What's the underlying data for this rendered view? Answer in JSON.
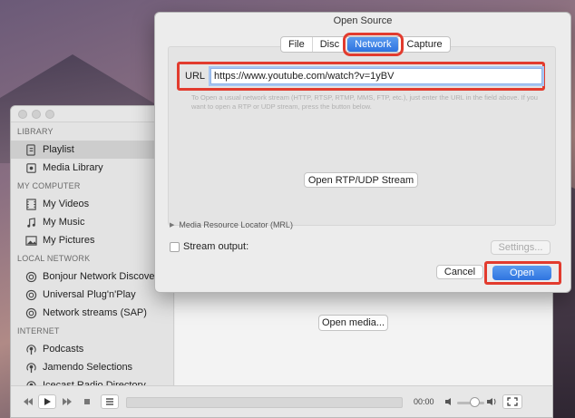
{
  "dialog": {
    "title": "Open Source",
    "tabs": [
      "File",
      "Disc",
      "Network",
      "Capture"
    ],
    "active_tab": "Network",
    "url_label": "URL",
    "url_value": "https://www.youtube.com/watch?v=1yBV",
    "help_text": "To Open a usual network stream (HTTP, RTSP, RTMP, MMS, FTP, etc.), just enter the URL in the field above. If you want to open a RTP or UDP stream, press the button below.",
    "rtp_button": "Open RTP/UDP Stream",
    "mrl_label": "Media Resource Locator (MRL)",
    "stream_output_label": "Stream output:",
    "settings_button": "Settings...",
    "cancel_button": "Cancel",
    "open_button": "Open",
    "highlight_color": "#e23b2e",
    "accent_color": "#2f74e0"
  },
  "sidebar": {
    "sections": [
      {
        "title": "LIBRARY",
        "items": [
          {
            "label": "Playlist",
            "icon": "playlist-icon",
            "selected": true
          },
          {
            "label": "Media Library",
            "icon": "music-icon",
            "selected": false
          }
        ]
      },
      {
        "title": "MY COMPUTER",
        "items": [
          {
            "label": "My Videos",
            "icon": "film-icon"
          },
          {
            "label": "My Music",
            "icon": "music-note-icon"
          },
          {
            "label": "My Pictures",
            "icon": "picture-icon"
          }
        ]
      },
      {
        "title": "LOCAL NETWORK",
        "items": [
          {
            "label": "Bonjour Network Discovery",
            "icon": "network-icon"
          },
          {
            "label": "Universal Plug'n'Play",
            "icon": "network-icon"
          },
          {
            "label": "Network streams (SAP)",
            "icon": "network-icon"
          }
        ]
      },
      {
        "title": "INTERNET",
        "items": [
          {
            "label": "Podcasts",
            "icon": "podcast-icon"
          },
          {
            "label": "Jamendo Selections",
            "icon": "podcast-icon"
          },
          {
            "label": "Icecast Radio Directory",
            "icon": "podcast-icon"
          }
        ]
      }
    ]
  },
  "main": {
    "open_media_button": "Open media..."
  },
  "controls": {
    "time": "00:00"
  }
}
